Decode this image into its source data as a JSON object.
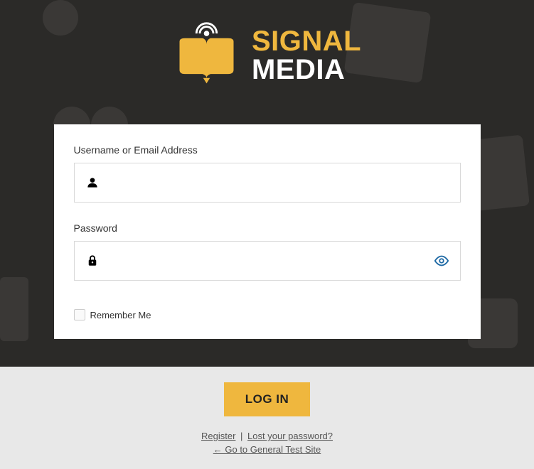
{
  "logo": {
    "line1": "SIGNAL",
    "line2": "MEDIA"
  },
  "form": {
    "username_label": "Username or Email Address",
    "username_value": "",
    "password_label": "Password",
    "password_value": "",
    "remember_label": "Remember Me"
  },
  "actions": {
    "login_button": "LOG IN",
    "register_link": "Register",
    "lost_password_link": "Lost your password?",
    "back_link": "← Go to General Test Site"
  },
  "colors": {
    "accent": "#efb73e",
    "dark_bg": "#2b2a28"
  }
}
